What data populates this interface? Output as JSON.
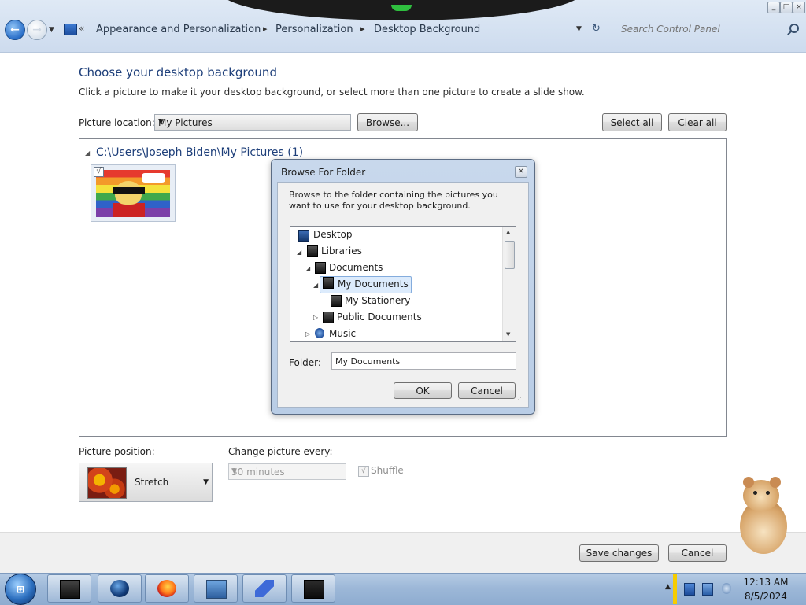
{
  "window": {
    "nav": {
      "back_label": "Back",
      "forward_label": "Forward",
      "chevrons": "«",
      "breadcrumbs": [
        "Appearance and Personalization",
        "Personalization",
        "Desktop Background"
      ],
      "search_placeholder": "Search Control Panel"
    },
    "controls": {
      "minimize": "_",
      "maximize": "□",
      "close": "×"
    }
  },
  "main": {
    "title": "Choose your desktop background",
    "subtitle": "Click a picture to make it your desktop background, or select more than one picture to create a slide show.",
    "picture_location_label": "Picture location:",
    "picture_location_value": "My Pictures",
    "browse_label": "Browse...",
    "select_all_label": "Select all",
    "clear_all_label": "Clear all",
    "folder_path": "C:\\Users\\Joseph Biden\\My Pictures (1)",
    "thumbnail_checked": "√",
    "picture_position_label": "Picture position:",
    "picture_position_value": "Stretch",
    "change_every_label": "Change picture every:",
    "change_every_value": "30 minutes",
    "shuffle_label": "Shuffle",
    "shuffle_check": "√",
    "save_label": "Save changes",
    "cancel_label": "Cancel"
  },
  "dialog": {
    "title": "Browse For Folder",
    "close": "×",
    "description": "Browse to the folder containing the pictures you want to use for your desktop background.",
    "tree": [
      {
        "label": "Desktop",
        "expander": ""
      },
      {
        "label": "Libraries",
        "expander": "◢"
      },
      {
        "label": "Documents",
        "expander": "◢"
      },
      {
        "label": "My Documents",
        "expander": "◢",
        "selected": true
      },
      {
        "label": "My Stationery",
        "expander": ""
      },
      {
        "label": "Public Documents",
        "expander": "▷"
      },
      {
        "label": "Music",
        "expander": "▷"
      }
    ],
    "folder_label": "Folder:",
    "folder_value": "My Documents",
    "ok_label": "OK",
    "cancel_label": "Cancel"
  },
  "taskbar": {
    "start_label": "Start",
    "buttons": [
      "terminal-icon",
      "globe-icon",
      "firefox-icon",
      "network-setup-icon",
      "bird-icon",
      "media-icon"
    ],
    "clock_time": "12:13 AM",
    "clock_date": "8/5/2024"
  },
  "colors": {
    "accent": "#1e3f7a",
    "taskbar": "#9db8d8",
    "selection": "#dcebfc"
  }
}
